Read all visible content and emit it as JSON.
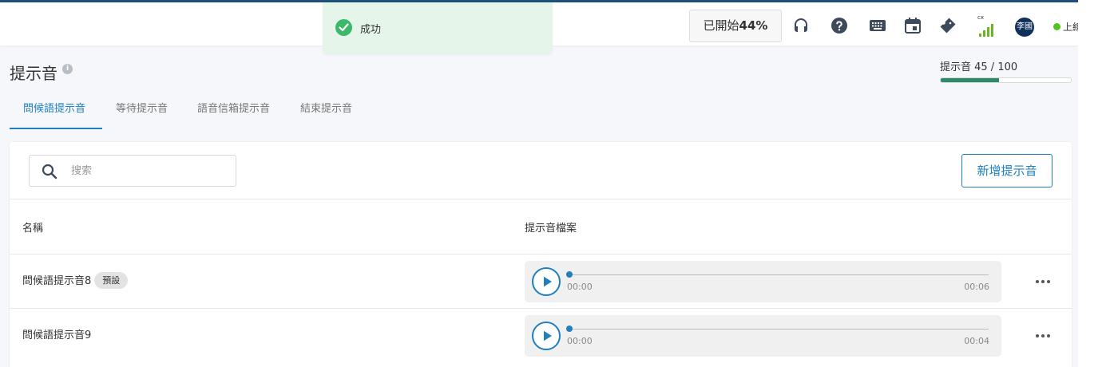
{
  "toast": {
    "message": "成功"
  },
  "header": {
    "started_prefix": "已開始",
    "started_percent": "44%",
    "signal_label": "cx",
    "avatar_text": "李國",
    "status_text": "上線",
    "icons": [
      "headset-icon",
      "help-icon",
      "keyboard-icon",
      "calendar-icon",
      "ticket-icon",
      "signal-icon"
    ]
  },
  "page": {
    "title": "提示音",
    "info_glyph": "i",
    "quota_label": "提示音 45 / 100",
    "quota_fraction": 0.45
  },
  "tabs": [
    {
      "label": "問候語提示音",
      "active": true
    },
    {
      "label": "等待提示音",
      "active": false
    },
    {
      "label": "語音信箱提示音",
      "active": false
    },
    {
      "label": "結束提示音",
      "active": false
    }
  ],
  "toolbar": {
    "search_placeholder": "搜索",
    "add_button": "新增提示音"
  },
  "table": {
    "columns": [
      "名稱",
      "提示音檔案"
    ],
    "rows": [
      {
        "name": "問候語提示音8",
        "badge": "預設",
        "current_time": "00:00",
        "duration": "00:06"
      },
      {
        "name": "問候語提示音9",
        "badge": "",
        "current_time": "00:00",
        "duration": "00:04"
      }
    ]
  },
  "colors": {
    "accent": "#1f7fbf",
    "success": "#3cb86a",
    "quota_fill": "#2e8b6a",
    "online": "#52c41a",
    "topline": "#1d4f7c"
  }
}
